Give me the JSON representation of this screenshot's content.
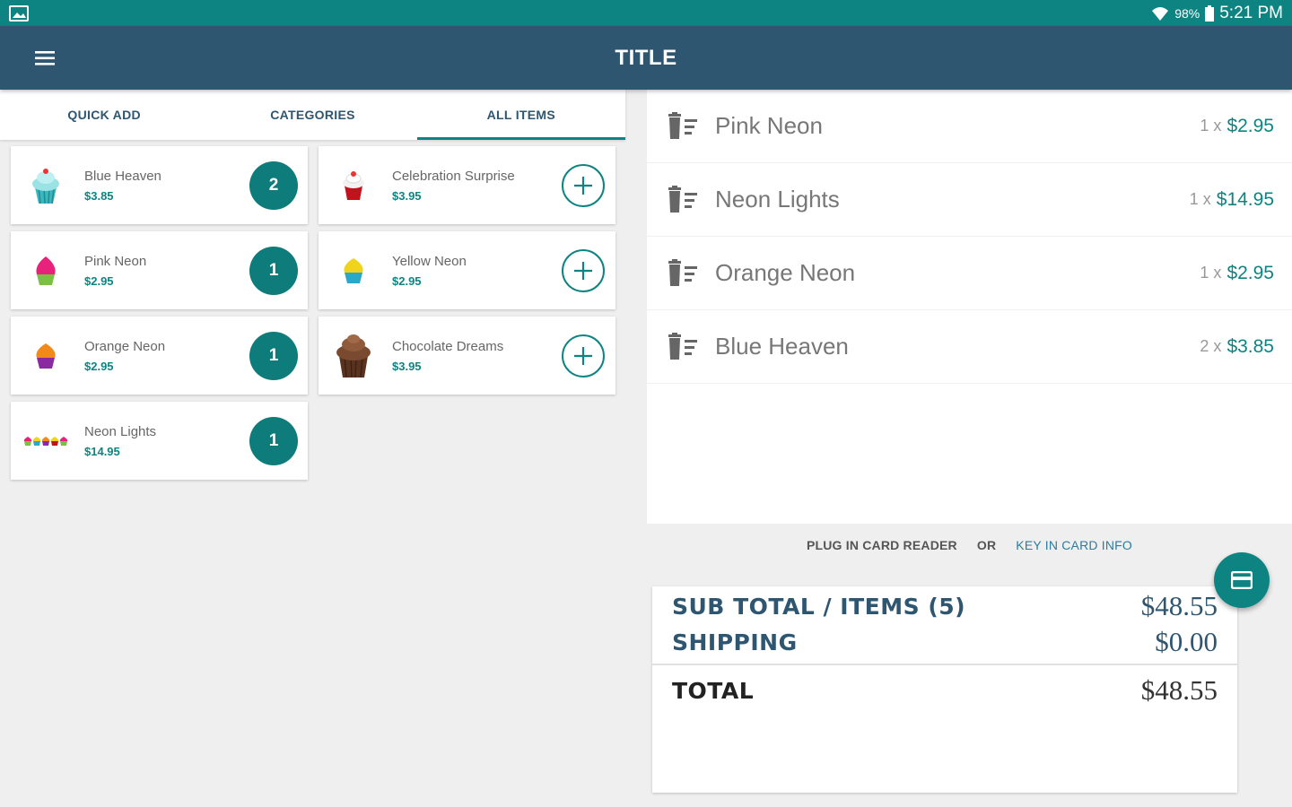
{
  "status": {
    "battery": "98%",
    "time": "5:21 PM"
  },
  "appbar": {
    "title": "TITLE"
  },
  "tabs": [
    {
      "label": "QUICK ADD",
      "active": false
    },
    {
      "label": "CATEGORIES",
      "active": false
    },
    {
      "label": "ALL ITEMS",
      "active": true
    }
  ],
  "products": [
    {
      "name": "Blue Heaven",
      "price": "$3.85",
      "count": "2",
      "icon": "blue-cupcake-icon"
    },
    {
      "name": "Celebration Surprise",
      "price": "$3.95",
      "count": null,
      "icon": "red-cupcake-icon"
    },
    {
      "name": "Pink Neon",
      "price": "$2.95",
      "count": "1",
      "icon": "pink-cupcake-icon"
    },
    {
      "name": "Yellow Neon",
      "price": "$2.95",
      "count": null,
      "icon": "yellow-cupcake-icon"
    },
    {
      "name": "Orange Neon",
      "price": "$2.95",
      "count": "1",
      "icon": "orange-cupcake-icon"
    },
    {
      "name": "Chocolate Dreams",
      "price": "$3.95",
      "count": null,
      "icon": "chocolate-cupcake-icon"
    },
    {
      "name": "Neon Lights",
      "price": "$14.95",
      "count": "1",
      "icon": "cupcake-row-icon"
    }
  ],
  "cart": [
    {
      "name": "Pink Neon",
      "qty": "1 x",
      "price": "$2.95"
    },
    {
      "name": "Neon Lights",
      "qty": "1 x",
      "price": "$14.95"
    },
    {
      "name": "Orange Neon",
      "qty": "1 x",
      "price": "$2.95"
    },
    {
      "name": "Blue Heaven",
      "qty": "2 x",
      "price": "$3.85"
    }
  ],
  "payment": {
    "plug": "PLUG IN CARD READER",
    "or": "OR",
    "key": "KEY IN CARD INFO"
  },
  "totals": {
    "subtotal_label": "SUB TOTAL / ITEMS (5)",
    "subtotal": "$48.55",
    "shipping_label": "SHIPPING",
    "shipping": "$0.00",
    "total_label": "TOTAL",
    "total": "$48.55"
  },
  "colors": {
    "teal": "#0e8482",
    "navy": "#2e5671"
  }
}
